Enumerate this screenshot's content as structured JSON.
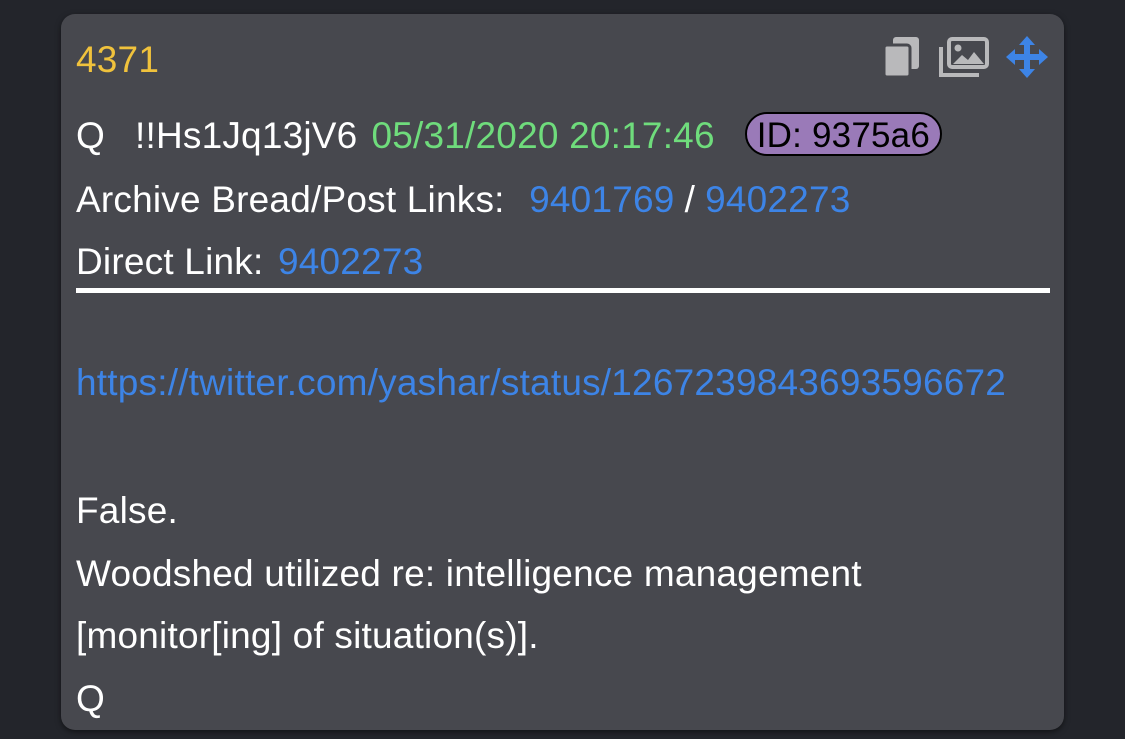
{
  "post": {
    "number": "4371",
    "author": "Q",
    "tripcode": "!!Hs1Jq13jV6",
    "timestamp": "05/31/2020 20:17:46",
    "id_label": "ID: 9375a6",
    "archive_label": "Archive Bread/Post Links:",
    "archive_link_1": "9401769",
    "archive_separator": "/",
    "archive_link_2": "9402273",
    "direct_label": "Direct Link:",
    "direct_link": "9402273",
    "body_link": "https://twitter.com/yashar/status/1267239843693596672",
    "body_lines": [
      "False.",
      "Woodshed utilized re: intelligence management",
      "[monitor[ing] of situation(s)].",
      "Q"
    ]
  },
  "toolbar": {
    "icons": [
      "copy-icon",
      "image-icon",
      "move-icon"
    ]
  },
  "colors": {
    "background": "#23252b",
    "card": "#47484e",
    "post_number": "#f0c23c",
    "timestamp": "#6fdc7c",
    "link": "#3d84e6",
    "id_badge": "#9a7ab8"
  }
}
